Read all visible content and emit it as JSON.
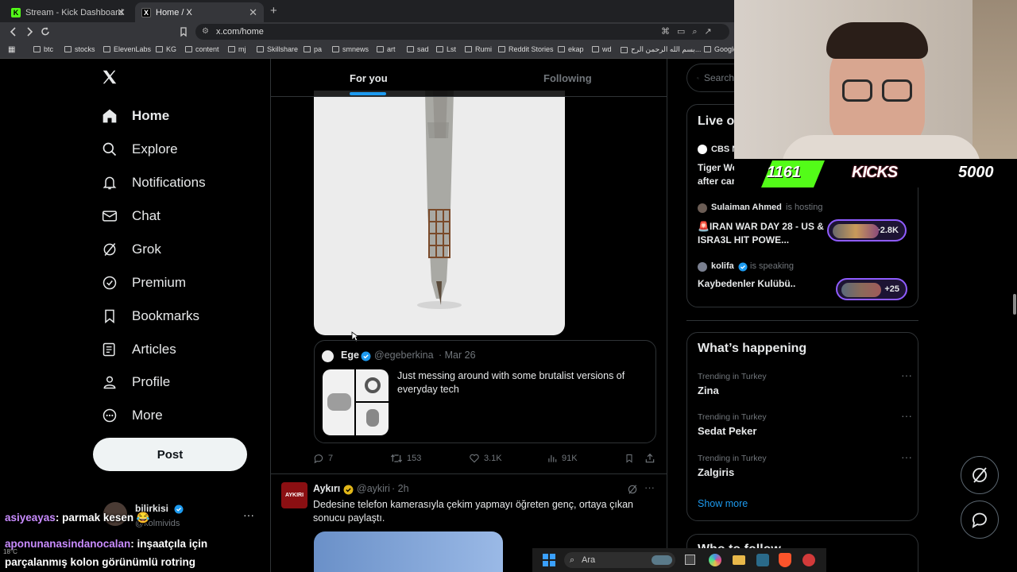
{
  "browser": {
    "tabs": [
      {
        "title": "Stream - Kick Dashboard",
        "favicon": "K"
      },
      {
        "title": "Home / X",
        "favicon": "X"
      }
    ],
    "url": "x.com/home",
    "bookmarks": [
      "btc",
      "stocks",
      "ElevenLabs",
      "KG",
      "content",
      "mj",
      "Skillshare",
      "pa",
      "smnews",
      "art",
      "sad",
      "Lst",
      "Rumi",
      "Reddit Stories",
      "ekap",
      "wd",
      "بسم الله الرحمن الرح...",
      "Google"
    ]
  },
  "sidebar": {
    "logo": "X",
    "items": [
      {
        "label": "Home",
        "icon": "home-icon"
      },
      {
        "label": "Explore",
        "icon": "search-icon"
      },
      {
        "label": "Notifications",
        "icon": "bell-icon"
      },
      {
        "label": "Chat",
        "icon": "mail-icon"
      },
      {
        "label": "Grok",
        "icon": "grok-icon"
      },
      {
        "label": "Premium",
        "icon": "verified-icon"
      },
      {
        "label": "Bookmarks",
        "icon": "bookmark-icon"
      },
      {
        "label": "Articles",
        "icon": "article-icon"
      },
      {
        "label": "Profile",
        "icon": "user-icon"
      },
      {
        "label": "More",
        "icon": "more-icon"
      }
    ],
    "post_label": "Post",
    "account": {
      "name": "bilirkisi",
      "handle": "@kolmivids"
    }
  },
  "feed": {
    "tabs": [
      "For you",
      "Following"
    ],
    "quote": {
      "name": "Ege",
      "handle": "@egeberkina",
      "date": "· Mar 26",
      "text": "Just messing around with some brutalist versions of everyday tech"
    },
    "metrics": {
      "replies": "7",
      "reposts": "153",
      "likes": "3.1K",
      "views": "91K"
    },
    "tweet2": {
      "avatar_text": "AYKIRI",
      "name": "Aykırı",
      "handle": "@aykiri",
      "time": "· 2h",
      "text": "Dedesine telefon kamerasıyla çekim yapmayı öğreten genç, ortaya çıkan sonucu paylaştı."
    }
  },
  "right": {
    "search_placeholder": "Search",
    "live": {
      "title": "Live on X",
      "items": [
        {
          "host": "CBS News",
          "suffix": "",
          "title": "Tiger Woods charged with DUI after car crash in Florida",
          "count": ""
        },
        {
          "host": "Sulaiman Ahmed",
          "suffix": "is hosting",
          "title": "🚨IRAN WAR DAY 28 - US & ISRA3L HIT POWE...",
          "count": "+2.8K"
        },
        {
          "host": "kolifa",
          "suffix": "is speaking",
          "title": "Kaybedenler Kulübü..",
          "count": "+25"
        }
      ]
    },
    "happening": {
      "title": "What’s happening",
      "trends": [
        {
          "category": "Trending in Turkey",
          "name": "Zina"
        },
        {
          "category": "Trending in Turkey",
          "name": "Sedat Peker"
        },
        {
          "category": "Trending in Turkey",
          "name": "Zalgiris"
        }
      ],
      "show_more": "Show more"
    },
    "next_title": "Who to follow"
  },
  "stream_overlay": {
    "counter": "1161",
    "kicks_label": "KICKS",
    "goal": "5000",
    "chat": [
      {
        "user": "asiyeayas",
        "message": ": parmak kesen 😂"
      },
      {
        "user": "aponunanasindanocalan",
        "message": ": inşaatçıla için parçalanmış kolon görünümlü rotring"
      }
    ]
  },
  "taskbar": {
    "search": "Ara",
    "weather": "18°C"
  },
  "colors": {
    "accent": "#1d9bf0",
    "kick_green": "#53fc18",
    "chat_user": "#c98cff"
  }
}
